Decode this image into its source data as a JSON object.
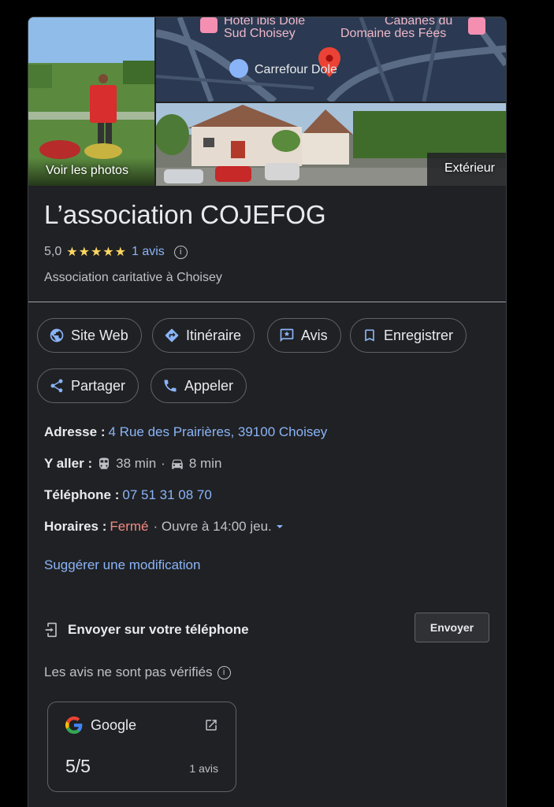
{
  "photos": {
    "main_label": "Voir les photos",
    "exterior_label": "Extérieur",
    "map_labels": {
      "hotel_line1": "Hôtel ibis Dole",
      "hotel_line2": "Sud Choisey",
      "cabanes_line1": "Cabanes du",
      "cabanes_line2": "Domaine des Fées",
      "carrefour": "Carrefour Dole"
    }
  },
  "place": {
    "name": "L’association COJEFOG",
    "rating": "5,0",
    "stars": "★★★★★",
    "reviews_link": "1 avis",
    "category": "Association caritative à Choisey"
  },
  "actions": {
    "website": "Site Web",
    "directions": "Itinéraire",
    "reviews": "Avis",
    "save": "Enregistrer",
    "share": "Partager",
    "call": "Appeler"
  },
  "info": {
    "address_label": "Adresse :",
    "address_value": "4 Rue des Prairières, 39100 Choisey",
    "goto_label": "Y aller :",
    "transit_time": "38 min",
    "separator": "·",
    "car_time": "8 min",
    "phone_label": "Téléphone :",
    "phone_value": "07 51 31 08 70",
    "hours_label": "Horaires :",
    "hours_status": "Fermé",
    "hours_next": "· Ouvre à 14:00 jeu."
  },
  "suggest_edit": "Suggérer une modification",
  "send": {
    "label": "Envoyer sur votre téléphone",
    "button": "Envoyer"
  },
  "reviews_notice": "Les avis ne sont pas vérifiés",
  "review_card": {
    "source": "Google",
    "score": "5/5",
    "count": "1 avis"
  },
  "colors": {
    "background": "#202124",
    "link": "#8ab4f8",
    "star": "#fdd663",
    "closed": "#f28b82"
  }
}
